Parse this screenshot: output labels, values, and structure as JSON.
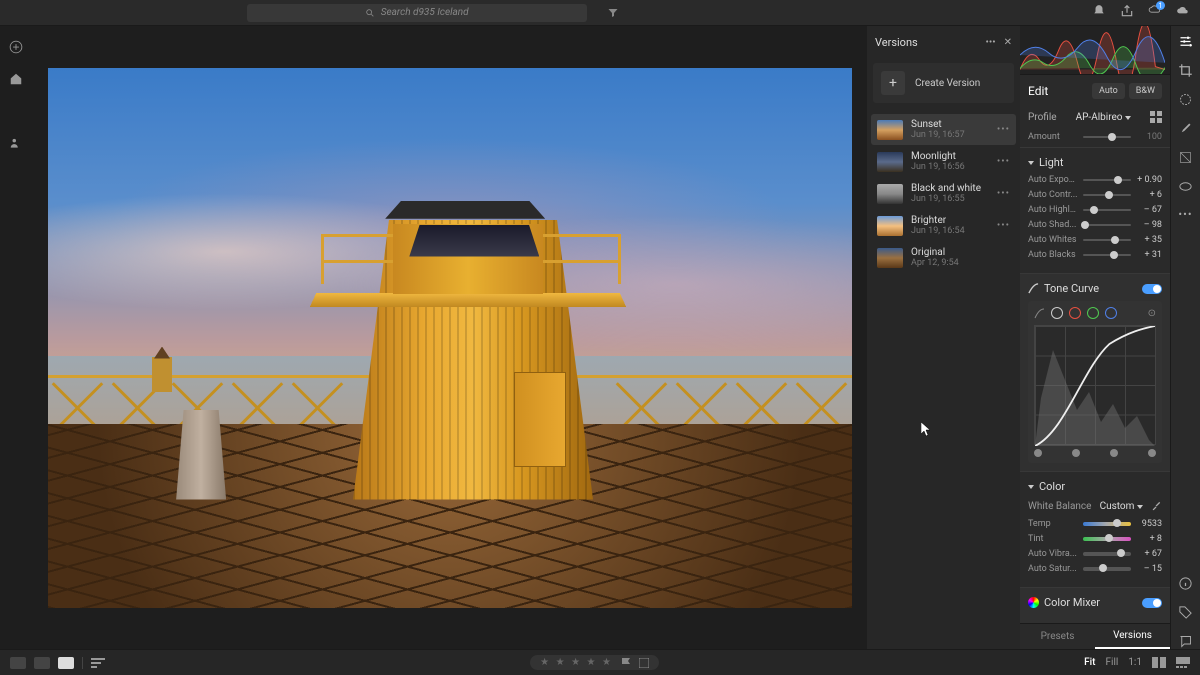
{
  "search": {
    "placeholder": "Search d935 Iceland"
  },
  "topbar": {
    "notif_count": "1"
  },
  "versions_panel": {
    "title": "Versions",
    "create_label": "Create Version",
    "items": [
      {
        "name": "Sunset",
        "date": "Jun 19, 16:57",
        "active": true,
        "thumb": "linear-gradient(180deg,#4a7ab8 0%,#d4a060 50%,#8a5020 100%)"
      },
      {
        "name": "Moonlight",
        "date": "Jun 19, 16:56",
        "active": false,
        "thumb": "linear-gradient(180deg,#2a3a5a 0%,#5a6a8a 50%,#3a3020 100%)"
      },
      {
        "name": "Black and white",
        "date": "Jun 19, 16:55",
        "active": false,
        "thumb": "linear-gradient(180deg,#aaa 0%,#888 50%,#333 100%)"
      },
      {
        "name": "Brighter",
        "date": "Jun 19, 16:54",
        "active": false,
        "thumb": "linear-gradient(180deg,#6a9ad8 0%,#f4c080 50%,#aa7030 100%)"
      },
      {
        "name": "Original",
        "date": "Apr 12, 9:54",
        "active": false,
        "thumb": "linear-gradient(180deg,#3a5a8a 0%,#9a7040 50%,#5a3818 100%)"
      }
    ]
  },
  "edit_panel": {
    "title": "Edit",
    "auto_btn": "Auto",
    "bw_btn": "B&W",
    "profile_label": "Profile",
    "profile_value": "AP-Albireo",
    "amount_label": "Amount",
    "amount_value": "100",
    "light": {
      "title": "Light",
      "sliders": [
        {
          "label": "Auto Expos...",
          "value": "+ 0.90",
          "pos": 72
        },
        {
          "label": "Auto Contr...",
          "value": "+ 6",
          "pos": 54
        },
        {
          "label": "Auto Highli...",
          "value": "– 67",
          "pos": 22
        },
        {
          "label": "Auto Shad...",
          "value": "– 98",
          "pos": 5
        },
        {
          "label": "Auto Whites",
          "value": "+ 35",
          "pos": 66
        },
        {
          "label": "Auto Blacks",
          "value": "+ 31",
          "pos": 64
        }
      ]
    },
    "tone_curve": {
      "title": "Tone Curve"
    },
    "color": {
      "title": "Color",
      "wb_label": "White Balance",
      "wb_value": "Custom",
      "sliders": [
        {
          "label": "Temp",
          "value": "9533",
          "pos": 70,
          "gradient": "linear-gradient(90deg,#3a7ad4,#aaa,#e8c040)"
        },
        {
          "label": "Tint",
          "value": "+ 8",
          "pos": 54,
          "gradient": "linear-gradient(90deg,#3ac050,#aaa,#d850c0)"
        },
        {
          "label": "Auto Vibra...",
          "value": "+ 67",
          "pos": 80,
          "gradient": "#555"
        },
        {
          "label": "Auto Satur...",
          "value": "– 15",
          "pos": 42,
          "gradient": "#555"
        }
      ]
    },
    "color_mixer": {
      "title": "Color Mixer"
    },
    "tabs": {
      "presets": "Presets",
      "versions": "Versions"
    }
  },
  "bottombar": {
    "fit": "Fit",
    "fill": "Fill",
    "one": "1:1",
    "stars": "★ ★ ★ ★ ★"
  }
}
